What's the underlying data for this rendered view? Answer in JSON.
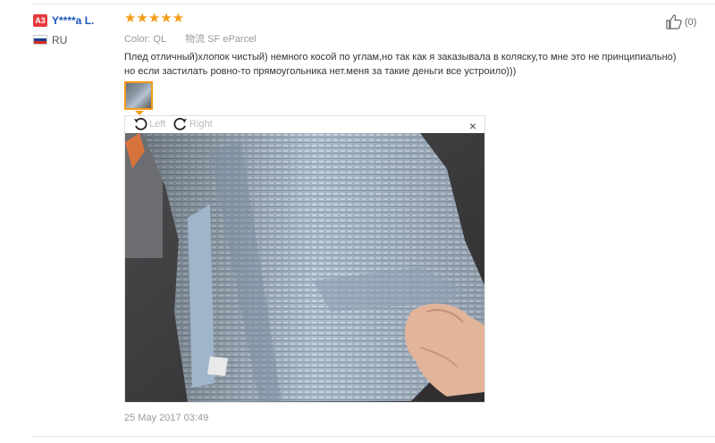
{
  "review": {
    "buyer": {
      "level_badge": "A3",
      "name": "Y****a L.",
      "country": "RU"
    },
    "rating": {
      "stars": 5,
      "stars_text": "★★★★★"
    },
    "color_label": "Color:",
    "color_value": "QL",
    "shipping_label": "物流",
    "shipping_value": "SF eParcel",
    "helpful_count": "(0)",
    "text": "Плед отличный)хлопок чистый) немного косой по углам,но так как я заказывала в коляску,то мне это не принципиально)\nно если застилать ровно-то прямоугольника нет.меня за такие деньги все устроило)))",
    "viewer": {
      "rotate_left": "Left",
      "rotate_right": "Right",
      "close": "×"
    },
    "date": "25 May 2017 03:49"
  },
  "colors": {
    "accent": "#f29b16",
    "badge": "#e4393c",
    "name": "#1a56b8",
    "muted": "#999999"
  },
  "icons": [
    "thumbs-up-icon",
    "rotate-left-icon",
    "rotate-right-icon",
    "close-icon",
    "russia-flag-icon"
  ]
}
